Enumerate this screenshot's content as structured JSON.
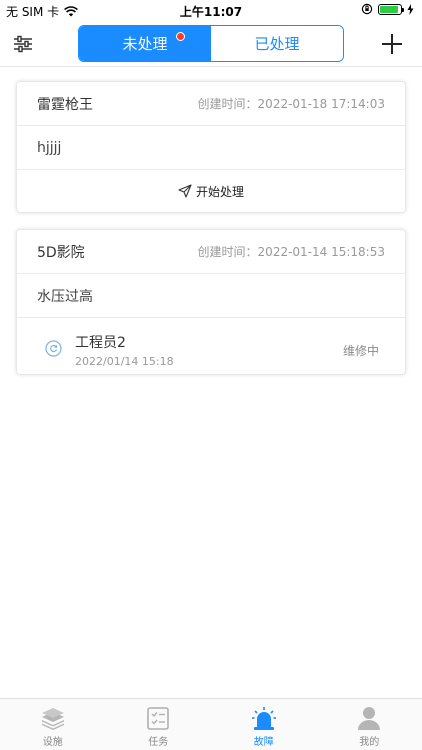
{
  "status_bar": {
    "carrier": "无 SIM 卡",
    "time": "上午11:07",
    "battery_level": 0.9
  },
  "nav": {
    "tabs": [
      {
        "label": "未处理",
        "active": true,
        "has_badge": true
      },
      {
        "label": "已处理",
        "active": false
      }
    ],
    "accent_color": "#1a8cff"
  },
  "faults": [
    {
      "title": "雷霆枪王",
      "created_label": "创建时间：",
      "created_time": "2022-01-18 17:14:03",
      "description": "hjjjj",
      "action_label": "开始处理"
    },
    {
      "title": "5D影院",
      "created_label": "创建时间：",
      "created_time": "2022-01-14 15:18:53",
      "description": "水压过高",
      "engineer": {
        "name": "工程员2",
        "date": "2022/01/14 15:18",
        "status": "维修中"
      }
    }
  ],
  "tab_bar": {
    "items": [
      {
        "label": "设施",
        "icon": "layers-icon",
        "active": false
      },
      {
        "label": "任务",
        "icon": "task-list-icon",
        "active": false
      },
      {
        "label": "故障",
        "icon": "alarm-siren-icon",
        "active": true
      },
      {
        "label": "我的",
        "icon": "user-icon",
        "active": false
      }
    ]
  }
}
